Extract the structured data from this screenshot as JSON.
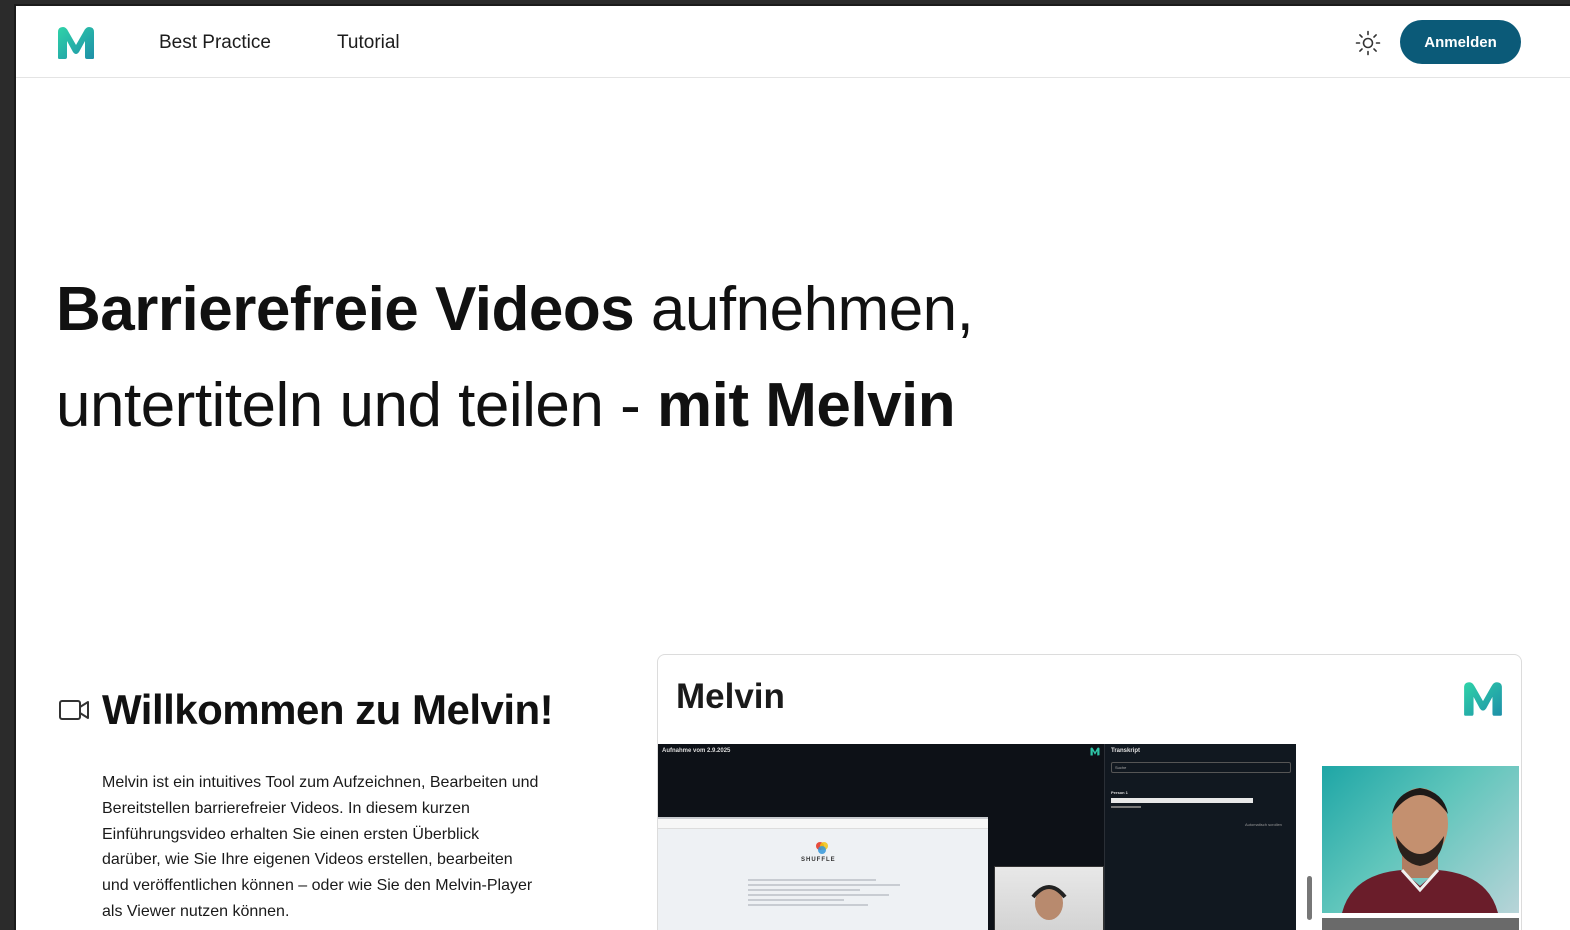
{
  "header": {
    "logo_alt": "Melvin logo",
    "nav": [
      {
        "label": "Best Practice"
      },
      {
        "label": "Tutorial"
      }
    ],
    "theme_icon": "sun-icon",
    "login_label": "Anmelden"
  },
  "hero": {
    "line1_bold": "Barrierefreie Videos",
    "line1_regular": " aufnehmen,",
    "line2_regular": "untertiteln und teilen - ",
    "line2_bold": "mit Melvin"
  },
  "welcome": {
    "icon": "video-camera-icon",
    "title": "Willkommen zu Melvin!",
    "text": "Melvin ist ein intuitives Tool zum Aufzeichnen, Bearbeiten und Bereitstellen barrierefreier Videos. In diesem kurzen Einführungsvideo erhalten Sie einen ersten Überblick darüber, wie Sie Ihre eigenen Videos erstellen, bearbeiten und veröffentlichen können – oder wie Sie den Melvin-Player als Viewer nutzen können."
  },
  "player": {
    "title": "Melvin",
    "screen_title": "Aufnahme vom 2.9.2025",
    "transcript_label": "Transkript",
    "search_placeholder": "Suche",
    "person_label": "Person 1",
    "autoscroll_label": "Automatisch scrollen",
    "shuffle_brand": "SHUFFLE"
  },
  "colors": {
    "accent": "#0b5a78",
    "logo_gradient_start": "#2ec4a6",
    "logo_gradient_end": "#1e8fa8"
  }
}
